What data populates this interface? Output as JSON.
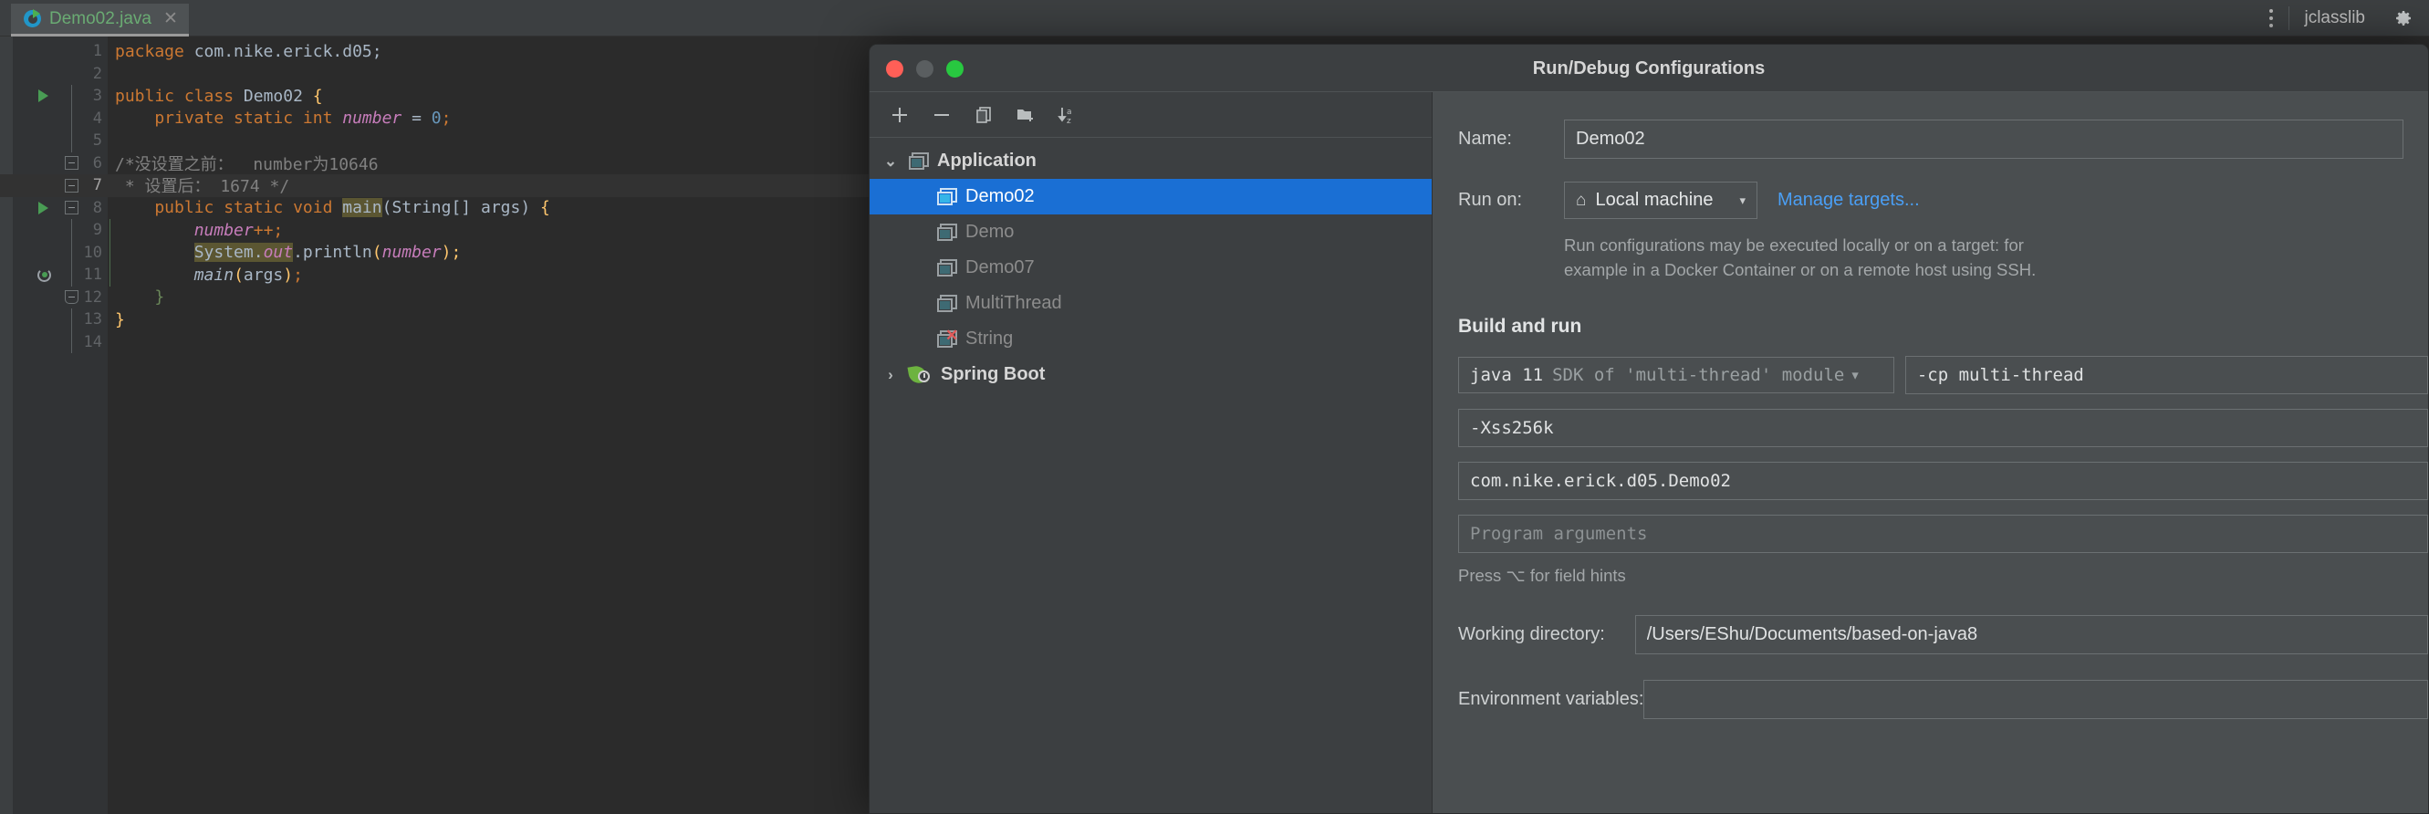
{
  "ide": {
    "tab": {
      "label": "Demo02.java",
      "close": "✕",
      "icon": "java-class-run-icon"
    },
    "topbar_right": {
      "kebab": "more-options",
      "title": "jclasslib",
      "gear": "⚙"
    },
    "editor": {
      "lines": [
        {
          "n": "1",
          "segments": [
            {
              "t": "package ",
              "c": "k"
            },
            {
              "t": "com.nike.erick.d05;",
              "c": "plain"
            }
          ]
        },
        {
          "n": "2",
          "segments": []
        },
        {
          "n": "3",
          "marker": "run",
          "segments": [
            {
              "t": "public class ",
              "c": "k"
            },
            {
              "t": "Demo02 ",
              "c": "cls"
            },
            {
              "t": "{",
              "c": "br-y"
            }
          ]
        },
        {
          "n": "4",
          "segments": [
            {
              "t": "    private static int ",
              "c": "k"
            },
            {
              "t": "number",
              "c": "fld"
            },
            {
              "t": " = ",
              "c": "plain"
            },
            {
              "t": "0",
              "c": "num"
            },
            {
              "t": ";",
              "c": "k"
            }
          ]
        },
        {
          "n": "5",
          "segments": []
        },
        {
          "n": "6",
          "fold": "top",
          "segments": [
            {
              "t": "/*没设置之前：  number为10646",
              "c": "cmt"
            }
          ]
        },
        {
          "n": "7",
          "highlight": true,
          "fold": "mid",
          "segments": [
            {
              "t": " * 设置后： 1674 */",
              "c": "cmt"
            }
          ]
        },
        {
          "n": "8",
          "marker": "run",
          "fold": "top",
          "segments": [
            {
              "t": "    public static void ",
              "c": "k"
            },
            {
              "t": "main",
              "c": "hit"
            },
            {
              "t": "(String[] args) ",
              "c": "plain"
            },
            {
              "t": "{",
              "c": "br-y"
            }
          ]
        },
        {
          "n": "9",
          "indent": true,
          "segments": [
            {
              "t": "        ",
              "c": "plain"
            },
            {
              "t": "number",
              "c": "fld"
            },
            {
              "t": "++;",
              "c": "k"
            }
          ]
        },
        {
          "n": "10",
          "indent": true,
          "segments": [
            {
              "t": "        ",
              "c": "plain"
            },
            {
              "t": "System.",
              "c": "hit"
            },
            {
              "t": "out",
              "c": "hit-it"
            },
            {
              "t": ".println",
              "c": "plain"
            },
            {
              "t": "(",
              "c": "br-y"
            },
            {
              "t": "number",
              "c": "fld"
            },
            {
              "t": ");",
              "c": "br-y"
            }
          ]
        },
        {
          "n": "11",
          "marker": "rerun",
          "indent": true,
          "segments": [
            {
              "t": "        ",
              "c": "plain"
            },
            {
              "t": "main",
              "c": "mth"
            },
            {
              "t": "(",
              "c": "br-y"
            },
            {
              "t": "args",
              "c": "plain"
            },
            {
              "t": ")",
              "c": "br-y"
            },
            {
              "t": ";",
              "c": "k"
            }
          ]
        },
        {
          "n": "12",
          "fold": "bottom",
          "segments": [
            {
              "t": "    }",
              "c": "br-g"
            }
          ]
        },
        {
          "n": "13",
          "segments": [
            {
              "t": "}",
              "c": "br-y"
            }
          ]
        },
        {
          "n": "14",
          "segments": []
        }
      ]
    }
  },
  "dialog": {
    "title": "Run/Debug Configurations",
    "window_controls": {
      "close": "close-button",
      "minimize": "minimize-button",
      "zoom": "zoom-button"
    },
    "toolbar": [
      {
        "name": "add-configuration-button",
        "glyph": "+"
      },
      {
        "name": "remove-configuration-button",
        "glyph": "−"
      },
      {
        "name": "copy-configuration-button",
        "glyph": "copy"
      },
      {
        "name": "new-folder-button",
        "glyph": "folder-plus"
      },
      {
        "name": "sort-alphabetically-button",
        "glyph": "sort-az"
      }
    ],
    "tree": [
      {
        "label": "Application",
        "type": "group",
        "expanded": true,
        "chevron": "⌄"
      },
      {
        "label": "Demo02",
        "type": "child",
        "selected": true
      },
      {
        "label": "Demo",
        "type": "child"
      },
      {
        "label": "Demo07",
        "type": "child"
      },
      {
        "label": "MultiThread",
        "type": "child"
      },
      {
        "label": "String",
        "type": "child",
        "error": true,
        "error_glyph": "✕"
      },
      {
        "label": "Spring Boot",
        "type": "group",
        "expanded": false,
        "chevron": "›"
      }
    ],
    "form": {
      "name_label": "Name:",
      "name_value": "Demo02",
      "run_on_label": "Run on:",
      "run_on_value": "Local machine",
      "run_on_icon": "⌂",
      "run_on_caret": "▾",
      "manage_targets_link": "Manage targets...",
      "run_on_hint_line1": "Run configurations may be executed locally or on a target: for",
      "run_on_hint_line2": "example in a Docker Container or on a remote host using SSH.",
      "build_and_run_title": "Build and run",
      "sdk_value": "java 11",
      "sdk_suffix": "SDK of 'multi-thread' module",
      "sdk_caret": "▾",
      "cp_value": "-cp multi-thread",
      "vm_options_value": "-Xss256k",
      "main_class_value": "com.nike.erick.d05.Demo02",
      "program_arguments_placeholder": "Program arguments",
      "field_hints_text": "Press ⌥ for field hints",
      "working_directory_label": "Working directory:",
      "working_directory_value": "/Users/EShu/Documents/based-on-java8",
      "environment_variables_label": "Environment variables:"
    }
  },
  "colors": {
    "accent_selection": "#1a6fd4",
    "link": "#4a9ff5",
    "keyword": "#cc7832",
    "comment": "#808080",
    "field": "#c77dbb",
    "number": "#6897bb",
    "string_green": "#6a8759",
    "run_green": "#499c54",
    "traffic_red": "#ff5f57",
    "traffic_green": "#28c840"
  }
}
